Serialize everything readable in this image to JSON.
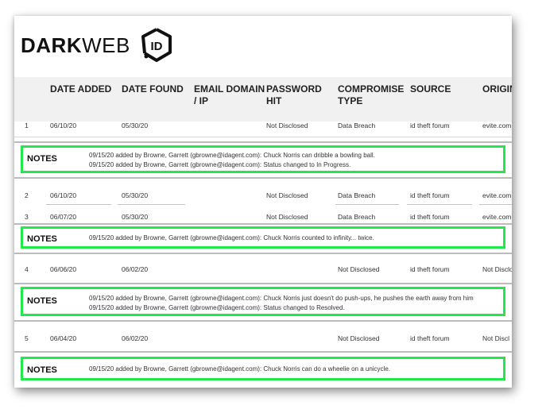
{
  "brand": {
    "logo_bold": "DARK",
    "logo_light": "WEB",
    "badge_text": "ID"
  },
  "columns": [
    "DATE ADDED",
    "DATE FOUND",
    "EMAIL DOMAIN / IP",
    "PASSWORD HIT",
    "COMPROMISE TYPE",
    "SOURCE",
    "ORIGIN"
  ],
  "records": [
    {
      "num": "1",
      "date_added": "06/10/20",
      "date_found": "05/30/20",
      "email_domain": "",
      "password_hit": "Not Disclosed",
      "compromise_type": "Data Breach",
      "source": "id theft forum",
      "origin": "evite.com"
    },
    {
      "num": "2",
      "date_added": "06/10/20",
      "date_found": "05/30/20",
      "email_domain": "",
      "password_hit": "Not Disclosed",
      "compromise_type": "Data Breach",
      "source": "id theft forum",
      "origin": "evite.com"
    },
    {
      "num": "3",
      "date_added": "06/07/20",
      "date_found": "05/30/20",
      "email_domain": "",
      "password_hit": "Not Disclosed",
      "compromise_type": "Data Breach",
      "source": "id theft forum",
      "origin": "evite.com"
    },
    {
      "num": "4",
      "date_added": "06/06/20",
      "date_found": "06/02/20",
      "email_domain": "",
      "password_hit": "",
      "compromise_type": "Not Disclosed",
      "source": "id theft forum",
      "origin": "Not Disclo"
    },
    {
      "num": "5",
      "date_added": "06/04/20",
      "date_found": "06/02/20",
      "email_domain": "",
      "password_hit": "",
      "compromise_type": "Not Disclosed",
      "source": "id theft forum",
      "origin": "Not Discl"
    }
  ],
  "notes": [
    {
      "label": "NOTES",
      "lines": [
        "09/15/20 added by Browne, Garrett (gbrowne@idagent.com): Chuck Norris can dribble a bowling ball.",
        "09/15/20 added by Browne, Garrett (gbrowne@idagent.com): Status changed to In Progress."
      ]
    },
    {
      "label": "NOTES",
      "lines": [
        "09/15/20 added by Browne, Garrett (gbrowne@idagent.com): Chuck Norris counted to infinity... twice."
      ]
    },
    {
      "label": "NOTES",
      "lines": [
        "09/15/20 added by Browne, Garrett (gbrowne@idagent.com): Chuck Norris just doesn't do push-ups, he pushes the earth away from him",
        "09/15/20 added by Browne, Garrett (gbrowne@idagent.com): Status changed to Resolved."
      ]
    },
    {
      "label": "NOTES",
      "lines": [
        "09/15/20 added by Browne, Garrett (gbrowne@idagent.com): Chuck Norris can do a wheelie on a unicycle."
      ]
    }
  ],
  "colors": {
    "highlight": "#22e84c",
    "header_band": "#f1f1f1"
  },
  "icons": {
    "badge": "hexagon-id-badge-icon"
  }
}
